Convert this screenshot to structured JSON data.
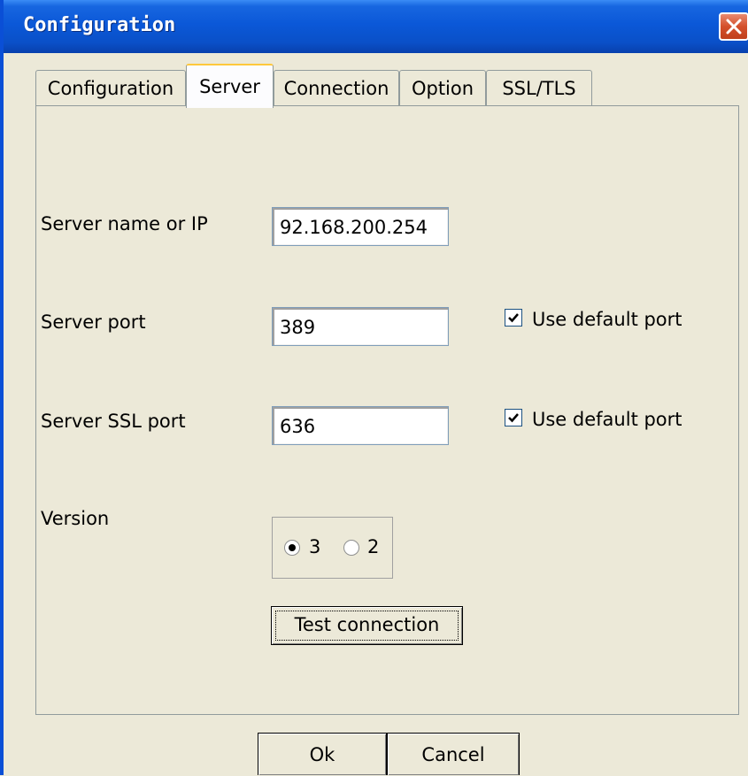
{
  "window": {
    "title": "Configuration"
  },
  "tabs": [
    {
      "label": "Configuration",
      "active": false
    },
    {
      "label": "Server",
      "active": true
    },
    {
      "label": "Connection",
      "active": false
    },
    {
      "label": "Option",
      "active": false
    },
    {
      "label": "SSL/TLS",
      "active": false
    }
  ],
  "server": {
    "name_label": "Server name or IP",
    "name_value": "92.168.200.254",
    "port_label": "Server port",
    "port_value": "389",
    "port_default_label": "Use default port",
    "port_default_checked": true,
    "ssl_port_label": "Server SSL port",
    "ssl_port_value": "636",
    "ssl_port_default_label": "Use default port",
    "ssl_port_default_checked": true,
    "version_label": "Version",
    "version_options": [
      "3",
      "2"
    ],
    "version_selected": "3",
    "test_button": "Test connection"
  },
  "footer": {
    "ok": "Ok",
    "cancel": "Cancel"
  },
  "colors": {
    "titlebar": "#0a50c8",
    "dialog_bg": "#ece9d8",
    "active_tab_accent": "#ffc83c",
    "close_button": "#d4502c"
  },
  "icons": {
    "close": "close-x-icon",
    "check": "checkmark-icon"
  }
}
